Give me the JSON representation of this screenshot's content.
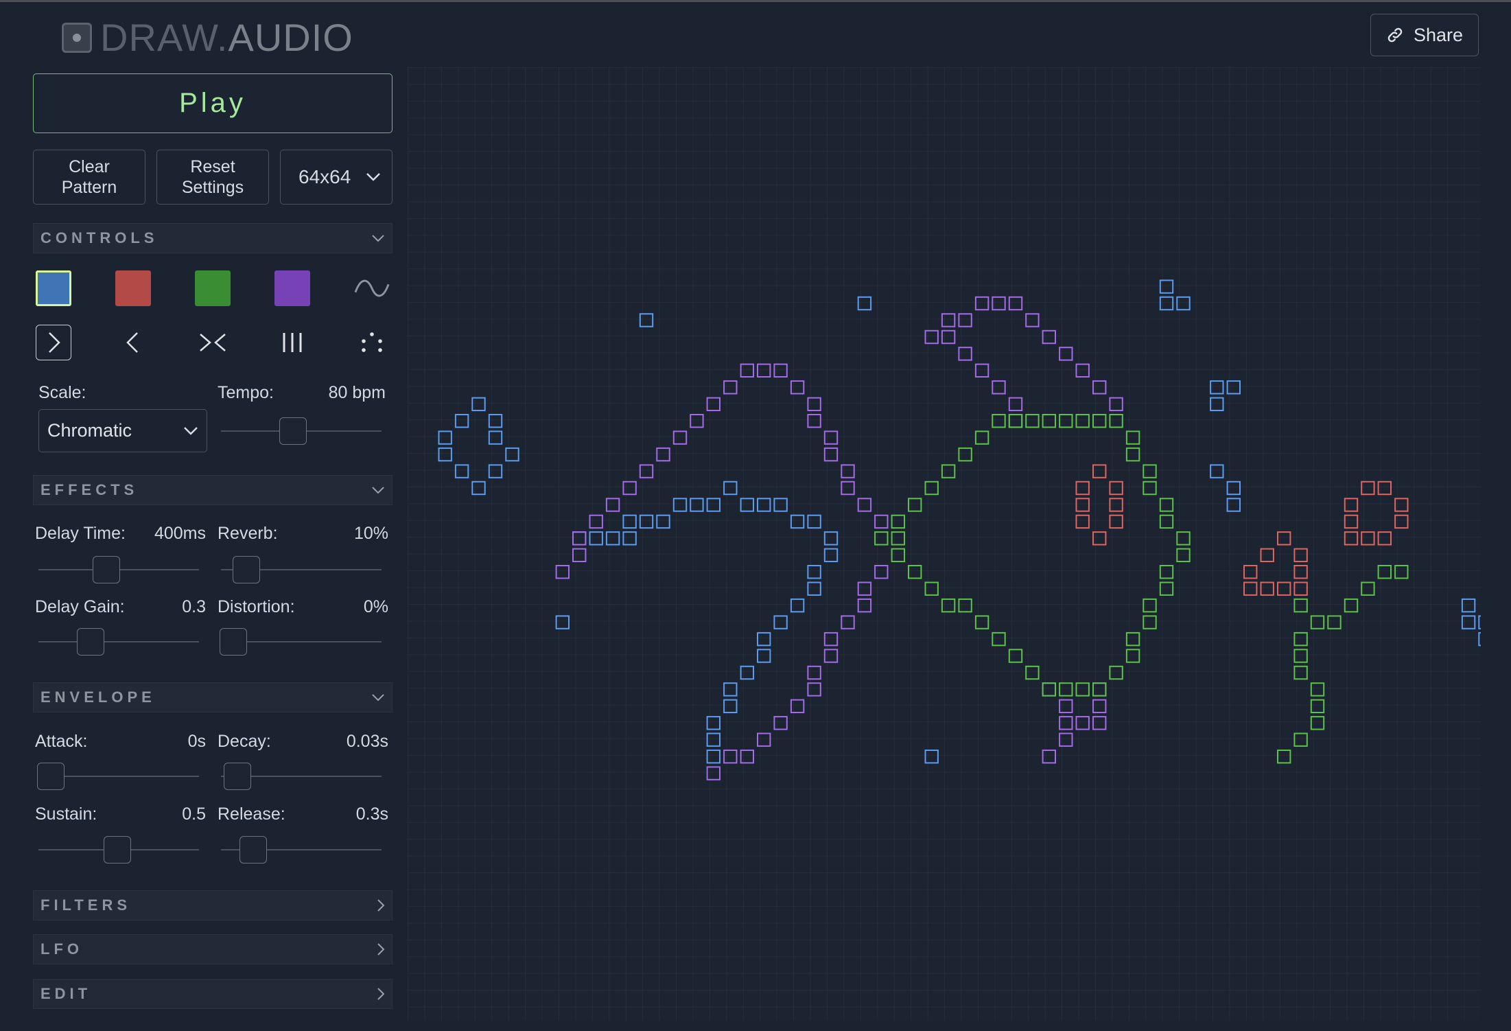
{
  "header": {
    "logo_part1": "DRAW.",
    "logo_part2": "AUDIO",
    "share_label": "Share"
  },
  "transport": {
    "play_label": "Play",
    "clear_label": "Clear Pattern",
    "reset_label": "Reset Settings",
    "grid_size": "64x64"
  },
  "sections": {
    "controls": "CONTROLS",
    "effects": "EFFECTS",
    "envelope": "ENVELOPE",
    "filters": "FILTERS",
    "lfo": "LFO",
    "edit": "EDIT"
  },
  "colors": {
    "blue": "#3f74b5",
    "red": "#b34a48",
    "green": "#3b8d33",
    "purple": "#7642b6",
    "selected_outline": "#d9f59a",
    "note_blue": "#5b9cf0",
    "note_purple": "#a46be8",
    "note_green": "#5cc248",
    "note_red": "#e0645f"
  },
  "selected_color": "blue",
  "waveform_icon": "sine-wave-icon",
  "direction_icons": [
    "play-forward-icon",
    "play-backward-icon",
    "play-inward-icon",
    "play-columns-icon",
    "play-random-icon"
  ],
  "controls": {
    "scale_label": "Scale:",
    "scale_value": "Chromatic",
    "tempo_label": "Tempo:",
    "tempo_value": "80 bpm",
    "tempo_level": 0.45
  },
  "effects": {
    "delay_time_label": "Delay Time:",
    "delay_time_value": "400ms",
    "delay_time_level": 0.42,
    "reverb_label": "Reverb:",
    "reverb_value": "10%",
    "reverb_level": 0.1,
    "delay_gain_label": "Delay Gain:",
    "delay_gain_value": "0.3",
    "delay_gain_level": 0.3,
    "distortion_label": "Distortion:",
    "distortion_value": "0%",
    "distortion_level": 0
  },
  "envelope": {
    "attack_label": "Attack:",
    "attack_value": "0s",
    "attack_level": 0,
    "decay_label": "Decay:",
    "decay_value": "0.03s",
    "decay_level": 0.03,
    "sustain_label": "Sustain:",
    "sustain_value": "0.5",
    "sustain_level": 0.5,
    "release_label": "Release:",
    "release_value": "0.3s",
    "release_level": 0.15
  },
  "pattern": {
    "blue": [
      [
        1,
        21
      ],
      [
        2,
        20
      ],
      [
        3,
        19
      ],
      [
        4,
        20
      ],
      [
        1,
        22
      ],
      [
        4,
        21
      ],
      [
        5,
        22
      ],
      [
        2,
        23
      ],
      [
        3,
        24
      ],
      [
        4,
        23
      ],
      [
        13,
        14
      ],
      [
        26,
        13
      ],
      [
        8,
        32
      ],
      [
        9,
        27
      ],
      [
        10,
        27
      ],
      [
        11,
        27
      ],
      [
        12,
        27
      ],
      [
        12,
        26
      ],
      [
        13,
        26
      ],
      [
        14,
        26
      ],
      [
        15,
        25
      ],
      [
        16,
        25
      ],
      [
        17,
        25
      ],
      [
        18,
        24
      ],
      [
        19,
        25
      ],
      [
        20,
        25
      ],
      [
        21,
        25
      ],
      [
        22,
        26
      ],
      [
        23,
        26
      ],
      [
        24,
        27
      ],
      [
        24,
        28
      ],
      [
        23,
        29
      ],
      [
        23,
        30
      ],
      [
        22,
        31
      ],
      [
        21,
        32
      ],
      [
        20,
        33
      ],
      [
        20,
        34
      ],
      [
        19,
        35
      ],
      [
        18,
        36
      ],
      [
        18,
        37
      ],
      [
        17,
        38
      ],
      [
        17,
        39
      ],
      [
        17,
        40
      ],
      [
        30,
        40
      ],
      [
        44,
        12
      ],
      [
        44,
        13
      ],
      [
        45,
        13
      ],
      [
        47,
        18
      ],
      [
        48,
        18
      ],
      [
        47,
        19
      ],
      [
        47,
        23
      ],
      [
        48,
        24
      ],
      [
        48,
        25
      ],
      [
        62,
        31
      ],
      [
        62,
        32
      ],
      [
        63,
        32
      ],
      [
        64,
        31
      ],
      [
        63,
        33
      ]
    ],
    "purple": [
      [
        8,
        29
      ],
      [
        9,
        28
      ],
      [
        9,
        27
      ],
      [
        10,
        26
      ],
      [
        11,
        25
      ],
      [
        12,
        24
      ],
      [
        13,
        23
      ],
      [
        14,
        22
      ],
      [
        15,
        21
      ],
      [
        16,
        20
      ],
      [
        17,
        19
      ],
      [
        18,
        18
      ],
      [
        19,
        17
      ],
      [
        20,
        17
      ],
      [
        21,
        17
      ],
      [
        22,
        18
      ],
      [
        23,
        19
      ],
      [
        23,
        20
      ],
      [
        24,
        21
      ],
      [
        24,
        22
      ],
      [
        25,
        23
      ],
      [
        25,
        24
      ],
      [
        26,
        25
      ],
      [
        27,
        26
      ],
      [
        30,
        15
      ],
      [
        31,
        15
      ],
      [
        31,
        14
      ],
      [
        32,
        14
      ],
      [
        33,
        13
      ],
      [
        34,
        13
      ],
      [
        35,
        13
      ],
      [
        36,
        14
      ],
      [
        37,
        15
      ],
      [
        38,
        16
      ],
      [
        39,
        17
      ],
      [
        40,
        18
      ],
      [
        41,
        19
      ],
      [
        32,
        16
      ],
      [
        33,
        17
      ],
      [
        34,
        18
      ],
      [
        35,
        19
      ],
      [
        35,
        20
      ],
      [
        26,
        30
      ],
      [
        26,
        31
      ],
      [
        25,
        32
      ],
      [
        24,
        33
      ],
      [
        24,
        34
      ],
      [
        23,
        35
      ],
      [
        23,
        36
      ],
      [
        22,
        37
      ],
      [
        21,
        38
      ],
      [
        20,
        39
      ],
      [
        19,
        40
      ],
      [
        18,
        40
      ],
      [
        17,
        41
      ],
      [
        27,
        29
      ],
      [
        37,
        36
      ],
      [
        38,
        37
      ],
      [
        38,
        38
      ],
      [
        38,
        39
      ],
      [
        37,
        40
      ],
      [
        39,
        38
      ],
      [
        40,
        37
      ],
      [
        40,
        36
      ],
      [
        40,
        38
      ]
    ],
    "green": [
      [
        28,
        28
      ],
      [
        29,
        29
      ],
      [
        30,
        30
      ],
      [
        31,
        31
      ],
      [
        32,
        31
      ],
      [
        33,
        32
      ],
      [
        34,
        33
      ],
      [
        35,
        34
      ],
      [
        36,
        35
      ],
      [
        37,
        36
      ],
      [
        38,
        36
      ],
      [
        39,
        36
      ],
      [
        40,
        36
      ],
      [
        41,
        35
      ],
      [
        42,
        34
      ],
      [
        42,
        33
      ],
      [
        43,
        32
      ],
      [
        43,
        31
      ],
      [
        44,
        30
      ],
      [
        44,
        29
      ],
      [
        45,
        28
      ],
      [
        45,
        27
      ],
      [
        44,
        26
      ],
      [
        44,
        25
      ],
      [
        43,
        24
      ],
      [
        43,
        23
      ],
      [
        42,
        22
      ],
      [
        42,
        21
      ],
      [
        41,
        20
      ],
      [
        40,
        20
      ],
      [
        39,
        20
      ],
      [
        38,
        20
      ],
      [
        37,
        20
      ],
      [
        36,
        20
      ],
      [
        35,
        20
      ],
      [
        34,
        20
      ],
      [
        33,
        21
      ],
      [
        32,
        22
      ],
      [
        31,
        23
      ],
      [
        30,
        24
      ],
      [
        29,
        25
      ],
      [
        28,
        26
      ],
      [
        27,
        27
      ],
      [
        28,
        27
      ],
      [
        52,
        31
      ],
      [
        53,
        32
      ],
      [
        52,
        33
      ],
      [
        52,
        34
      ],
      [
        52,
        35
      ],
      [
        53,
        37
      ],
      [
        53,
        38
      ],
      [
        53,
        36
      ],
      [
        52,
        39
      ],
      [
        51,
        40
      ],
      [
        55,
        31
      ],
      [
        56,
        30
      ],
      [
        57,
        29
      ],
      [
        58,
        29
      ],
      [
        54,
        32
      ]
    ],
    "red": [
      [
        39,
        24
      ],
      [
        39,
        25
      ],
      [
        39,
        26
      ],
      [
        40,
        23
      ],
      [
        40,
        27
      ],
      [
        41,
        24
      ],
      [
        41,
        25
      ],
      [
        41,
        26
      ],
      [
        49,
        29
      ],
      [
        50,
        28
      ],
      [
        51,
        27
      ],
      [
        52,
        28
      ],
      [
        52,
        29
      ],
      [
        52,
        30
      ],
      [
        51,
        30
      ],
      [
        50,
        30
      ],
      [
        49,
        30
      ],
      [
        55,
        25
      ],
      [
        55,
        26
      ],
      [
        56,
        24
      ],
      [
        57,
        24
      ],
      [
        58,
        25
      ],
      [
        58,
        26
      ],
      [
        57,
        27
      ],
      [
        56,
        27
      ],
      [
        55,
        27
      ]
    ]
  }
}
